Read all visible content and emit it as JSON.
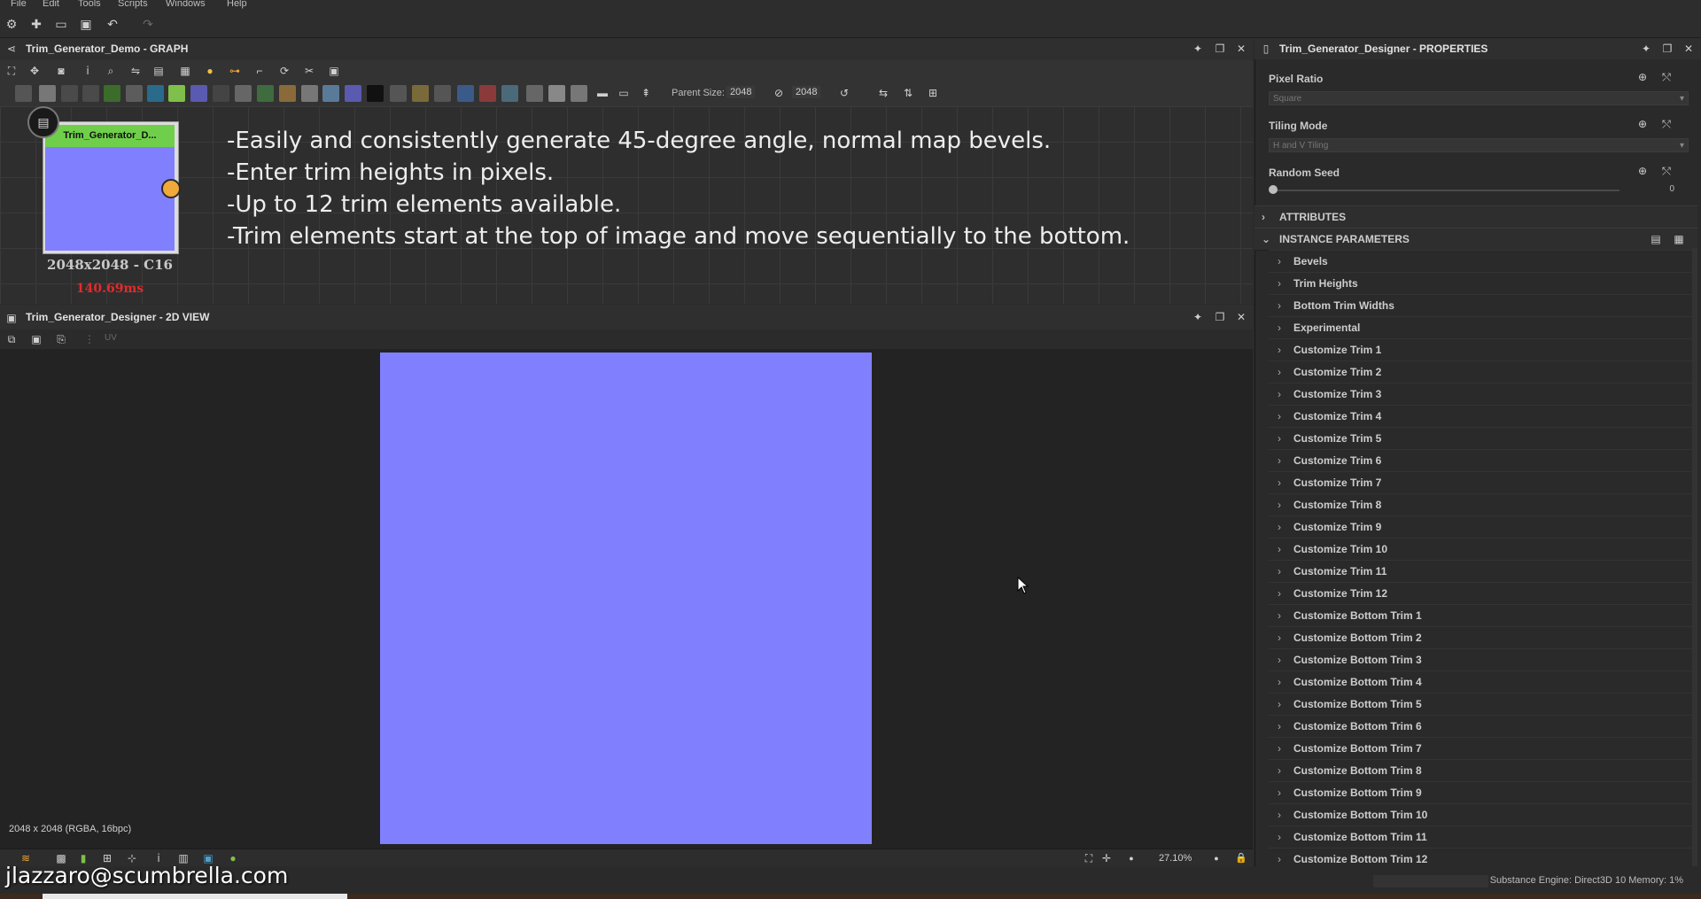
{
  "menu": [
    "File",
    "Edit",
    "Tools",
    "Scripts",
    "Windows",
    "Help"
  ],
  "graph": {
    "title": "Trim_Generator_Demo - GRAPH",
    "parent_size_label": "Parent Size:",
    "parent_size_w": "2048",
    "parent_size_h": "2048"
  },
  "node": {
    "title": "Trim_Generator_D...",
    "size": "2048x2048 - C16",
    "time": "140.69ms"
  },
  "comment_lines": [
    "-Easily and consistently generate 45-degree angle, normal map bevels.",
    "-Enter trim heights in pixels.",
    "-Up to 12 trim elements available.",
    "-Trim elements start at the top of image and move sequentially to the bottom."
  ],
  "view2d": {
    "title": "Trim_Generator_Designer - 2D VIEW",
    "uv_label": "UV",
    "info": "2048 x 2048 (RGBA, 16bpc)",
    "zoom": "27.10%"
  },
  "properties": {
    "title": "Trim_Generator_Designer - PROPERTIES",
    "pixel_ratio_label": "Pixel Ratio",
    "pixel_ratio_value": "Square",
    "tiling_mode_label": "Tiling Mode",
    "tiling_mode_value": "H and V Tiling",
    "random_seed_label": "Random Seed",
    "random_seed_value": "0",
    "attributes_label": "ATTRIBUTES",
    "instance_params_label": "INSTANCE PARAMETERS",
    "params": [
      "Bevels",
      "Trim Heights",
      "Bottom Trim Widths",
      "Experimental",
      "Customize Trim 1",
      "Customize Trim 2",
      "Customize Trim 3",
      "Customize Trim 4",
      "Customize Trim 5",
      "Customize Trim 6",
      "Customize Trim 7",
      "Customize Trim 8",
      "Customize Trim 9",
      "Customize Trim 10",
      "Customize Trim 11",
      "Customize Trim 12",
      "Customize Bottom Trim 1",
      "Customize Bottom Trim 2",
      "Customize Bottom Trim 3",
      "Customize Bottom Trim 4",
      "Customize Bottom Trim 5",
      "Customize Bottom Trim 6",
      "Customize Bottom Trim 7",
      "Customize Bottom Trim 8",
      "Customize Bottom Trim 9",
      "Customize Bottom Trim 10",
      "Customize Bottom Trim 11",
      "Customize Bottom Trim 12"
    ]
  },
  "status": {
    "engine": "Substance Engine: Direct3D 10  Memory: 1%",
    "watermark": "jlazzaro@scumbrella.com"
  },
  "colors": {
    "node_header": "#6fcf4a",
    "normal_map": "#8080ff",
    "output_port": "#f1a93a",
    "timing_red": "#e22b2b"
  }
}
